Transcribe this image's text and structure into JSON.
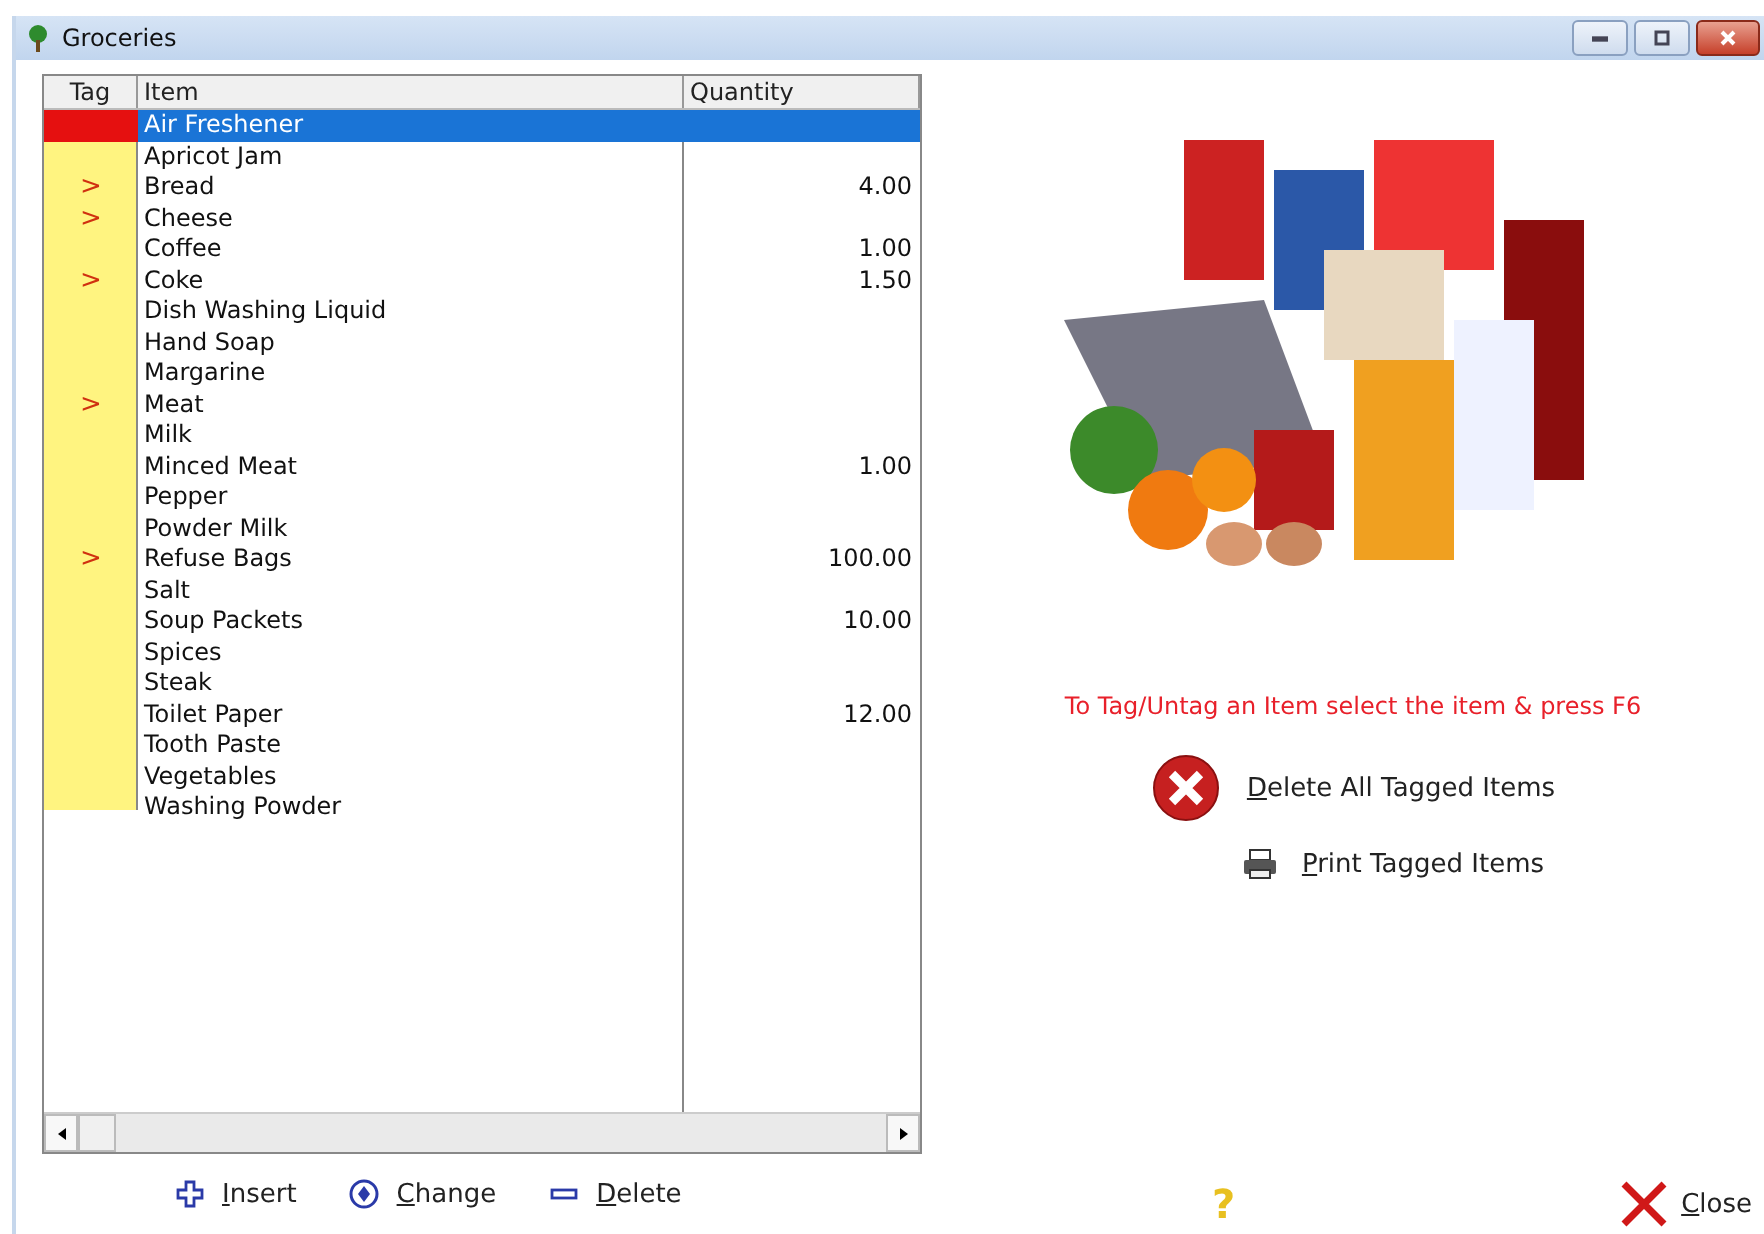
{
  "window": {
    "title": "Groceries"
  },
  "table": {
    "columns": [
      "Tag",
      "Item",
      "Quantity"
    ],
    "tag_mark": ">",
    "rows": [
      {
        "item": "Air Freshener",
        "quantity": "",
        "tagged": false,
        "selected": true
      },
      {
        "item": "Apricot Jam",
        "tagged": false,
        "selected": false
      },
      {
        "item": "Bread",
        "quantity": "4.00",
        "tagged": true,
        "selected": false
      },
      {
        "item": "Cheese",
        "tagged": true,
        "selected": false
      },
      {
        "item": "Coffee",
        "quantity": "1.00",
        "tagged": false,
        "selected": false
      },
      {
        "item": "Coke",
        "quantity": "1.50",
        "tagged": true,
        "selected": false
      },
      {
        "item": "Dish Washing Liquid",
        "tagged": false,
        "selected": false
      },
      {
        "item": "Hand Soap",
        "tagged": false,
        "selected": false
      },
      {
        "item": "Margarine",
        "tagged": false,
        "selected": false
      },
      {
        "item": "Meat",
        "tagged": true,
        "selected": false
      },
      {
        "item": "Milk",
        "tagged": false,
        "selected": false
      },
      {
        "item": "Minced Meat",
        "quantity": "1.00",
        "tagged": false,
        "selected": false
      },
      {
        "item": "Pepper",
        "tagged": false,
        "selected": false
      },
      {
        "item": "Powder Milk",
        "tagged": false,
        "selected": false
      },
      {
        "item": "Refuse Bags",
        "quantity": "100.00",
        "tagged": true,
        "selected": false
      },
      {
        "item": "Salt",
        "tagged": false,
        "selected": false
      },
      {
        "item": "Soup Packets",
        "quantity": "10.00",
        "tagged": false,
        "selected": false
      },
      {
        "item": "Spices",
        "tagged": false,
        "selected": false
      },
      {
        "item": "Steak",
        "tagged": false,
        "selected": false
      },
      {
        "item": "Toilet Paper",
        "quantity": "12.00",
        "tagged": false,
        "selected": false
      },
      {
        "item": "Tooth Paste",
        "tagged": false,
        "selected": false
      },
      {
        "item": "Vegetables",
        "tagged": false,
        "selected": false
      },
      {
        "item": "Washing Powder",
        "tagged": false,
        "selected": false
      }
    ]
  },
  "hint": "To Tag/Untag an Item select the item & press F6",
  "actions": [
    {
      "kind": "delete",
      "label": "Delete All Tagged Items"
    },
    {
      "kind": "print",
      "label": "Print Tagged Items"
    }
  ],
  "bottom_buttons": [
    {
      "kind": "insert",
      "label": "Insert"
    },
    {
      "kind": "change",
      "label": "Change"
    },
    {
      "kind": "delete",
      "label": "Delete"
    }
  ],
  "help": "?",
  "close": "Close"
}
